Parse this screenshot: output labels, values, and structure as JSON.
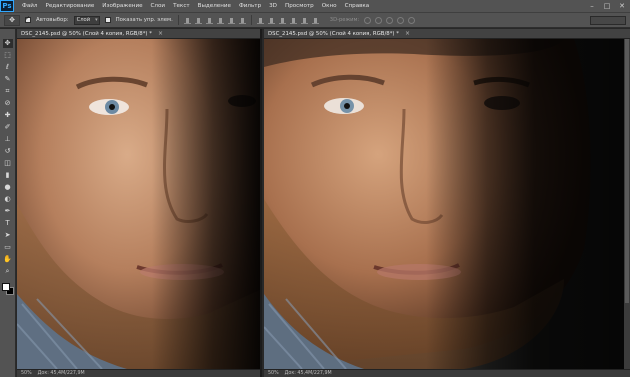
{
  "app": {
    "logo": "Ps"
  },
  "menu": {
    "items": [
      "Файл",
      "Редактирование",
      "Изображение",
      "Слои",
      "Текст",
      "Выделение",
      "Фильтр",
      "3D",
      "Просмотр",
      "Окно",
      "Справка"
    ]
  },
  "window_controls": {
    "minimize": "–",
    "maximize": "□",
    "close": "✕"
  },
  "options": {
    "auto_select_label": "Автовыбор:",
    "auto_select_checked": true,
    "auto_select_target": "Слой",
    "show_transform_label": "Показать упр. элем.",
    "show_transform_checked": false,
    "mode_3d_label": "3D-режим:",
    "workspace": ""
  },
  "tools": [
    {
      "name": "move-tool",
      "glyph": "✥"
    },
    {
      "name": "marquee-tool",
      "glyph": "⬚"
    },
    {
      "name": "lasso-tool",
      "glyph": "ℓ"
    },
    {
      "name": "quick-select-tool",
      "glyph": "✎"
    },
    {
      "name": "crop-tool",
      "glyph": "⌗"
    },
    {
      "name": "eyedropper-tool",
      "glyph": "⊘"
    },
    {
      "name": "healing-brush-tool",
      "glyph": "✚"
    },
    {
      "name": "brush-tool",
      "glyph": "✐"
    },
    {
      "name": "clone-stamp-tool",
      "glyph": "⊥"
    },
    {
      "name": "history-brush-tool",
      "glyph": "↺"
    },
    {
      "name": "eraser-tool",
      "glyph": "◫"
    },
    {
      "name": "gradient-tool",
      "glyph": "▮"
    },
    {
      "name": "blur-tool",
      "glyph": "●"
    },
    {
      "name": "dodge-tool",
      "glyph": "◐"
    },
    {
      "name": "pen-tool",
      "glyph": "✒"
    },
    {
      "name": "type-tool",
      "glyph": "T"
    },
    {
      "name": "path-select-tool",
      "glyph": "➤"
    },
    {
      "name": "shape-tool",
      "glyph": "▭"
    },
    {
      "name": "hand-tool",
      "glyph": "✋"
    },
    {
      "name": "zoom-tool",
      "glyph": "⌕"
    }
  ],
  "documents": [
    {
      "tab_title": "DSC_2145.psd @ 50% (Слой 4 копия, RGB/8*) *",
      "close": "×",
      "status_zoom": "50%",
      "status_info": "Док: 45,4M/227,9M"
    },
    {
      "tab_title": "DSC_2145.psd @ 50% (Слой 4 копия, RGB/8*) *",
      "close": "×",
      "status_zoom": "50%",
      "status_info": "Док: 45,4M/227,9M"
    }
  ]
}
